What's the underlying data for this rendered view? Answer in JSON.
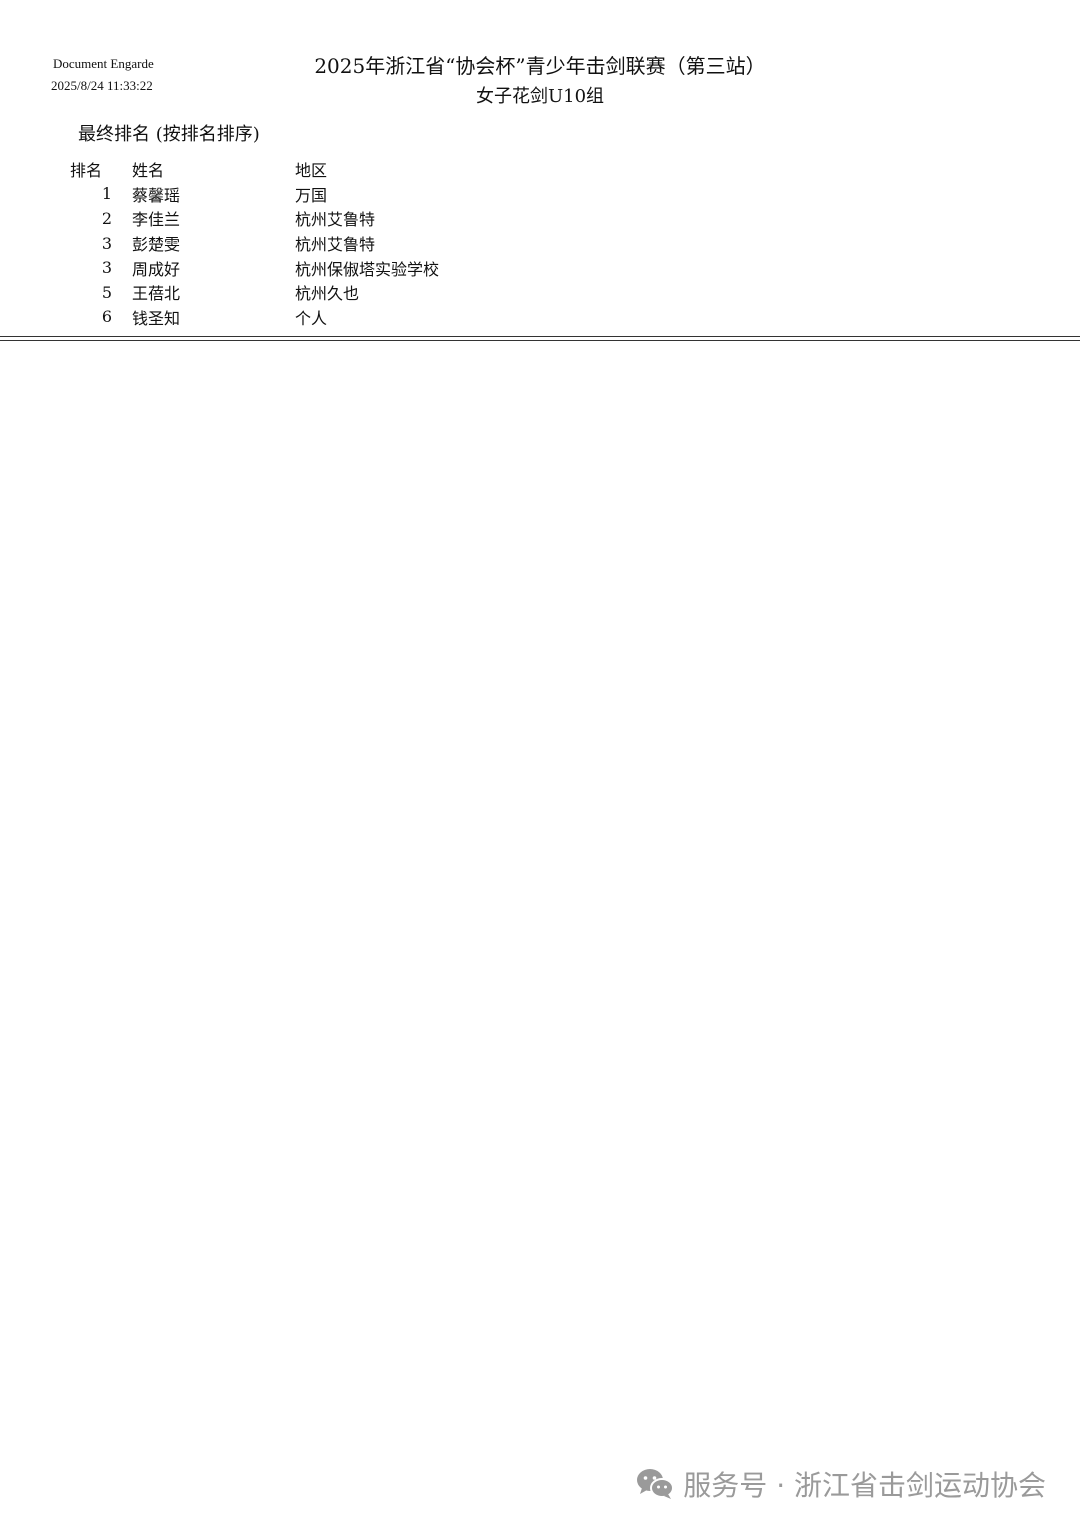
{
  "header": {
    "app_name": "Document Engarde",
    "timestamp": "2025/8/24 11:33:22",
    "title": "2025年浙江省“协会杯”青少年击剑联赛（第三站）",
    "subtitle": "女子花剑U10组"
  },
  "section_heading": "最终排名 (按排名排序)",
  "table": {
    "columns": [
      "排名",
      "姓名",
      "地区"
    ],
    "rows": [
      {
        "rank": "1",
        "name": "蔡馨瑶",
        "region": "万国"
      },
      {
        "rank": "2",
        "name": "李佳兰",
        "region": "杭州艾鲁特"
      },
      {
        "rank": "3",
        "name": "彭楚雯",
        "region": "杭州艾鲁特"
      },
      {
        "rank": "3",
        "name": "周成好",
        "region": "杭州保俶塔实验学校"
      },
      {
        "rank": "5",
        "name": "王蓓北",
        "region": "杭州久也"
      },
      {
        "rank": "6",
        "name": "钱圣知",
        "region": "个人"
      }
    ]
  },
  "watermark": {
    "text": "服务号 · 浙江省击剑运动协会",
    "icon": "wechat-icon"
  }
}
